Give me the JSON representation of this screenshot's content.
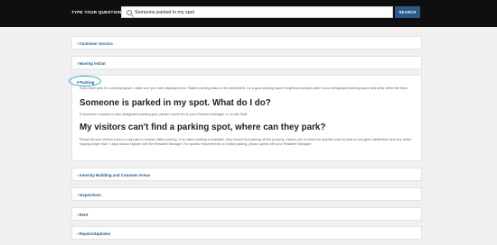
{
  "header": {
    "label": "TYPE YOUR QUESTION",
    "search_value": "Someone parked in my spot",
    "search_button": "SEARCH"
  },
  "sections": [
    {
      "label": "Customer Service",
      "expanded": false
    },
    {
      "label": "Moving In/Out",
      "expanded": false
    },
    {
      "label": "Parking",
      "expanded": true
    },
    {
      "label": "Amenity Building and Common Areas",
      "expanded": false
    },
    {
      "label": "Inspections",
      "expanded": false
    },
    {
      "label": "Rent",
      "expanded": false
    },
    {
      "label": "Repairs/Updates",
      "expanded": false
    }
  ],
  "parking": {
    "intro": "If you have paid for a parking space, make sure you have displayed your Skyline parking pass on the windshield. Go a good parking space neighbours always park in your designated parking space and keep within the lines.",
    "q1": "Someone is parked in my spot. What do I do?",
    "a1": "If someone is parked in your designated parking spot, please report this to your Resident Manager or on-site Staff.",
    "q2": "My visitors can't find a parking spot, where can they park?",
    "a2": "Please let your visitors know to only park in marked visitor parking. If no visitor parking is available, they should find parking off the property. Visitors are to follow the specific road by laws at any given destination and any visitor staying longer than 7 days should register with the Resident Manager. For specific requirements on visitor parking, please speak with your Resident Manager."
  }
}
